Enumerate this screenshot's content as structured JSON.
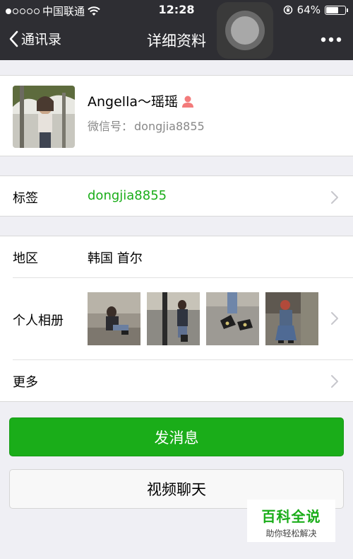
{
  "status_bar": {
    "carrier": "中国联通",
    "time": "12:28",
    "battery_percent": "64%",
    "battery_level": 0.64,
    "signal_dots_filled": 1,
    "signal_dots_total": 5
  },
  "nav": {
    "back_label": "通讯录",
    "title": "详细资料",
    "more_icon": "ellipsis-icon"
  },
  "profile": {
    "name": "Angella～瑶瑶",
    "gender_icon": "female-icon",
    "wechat_id_label": "微信号：",
    "wechat_id": "dongjia8855"
  },
  "tags": {
    "label": "标签",
    "value": "dongjia8855"
  },
  "details": {
    "region_label": "地区",
    "region_value": "韩国 首尔",
    "album_label": "个人相册",
    "more_label": "更多"
  },
  "actions": {
    "send_message": "发消息",
    "video_chat": "视频聊天"
  },
  "watermark": {
    "main": "百科全说",
    "sub": "助你轻松解决"
  },
  "colors": {
    "accent_green": "#1aad19",
    "nav_bg": "#2e2e33",
    "page_bg": "#efeff4",
    "female_icon": "#f37b7b"
  }
}
